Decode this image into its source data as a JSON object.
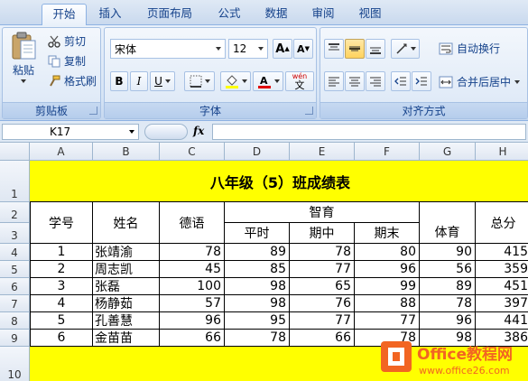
{
  "tabs": [
    "开始",
    "插入",
    "页面布局",
    "公式",
    "数据",
    "审阅",
    "视图"
  ],
  "clipboard": {
    "paste": "粘贴",
    "cut": "剪切",
    "copy": "复制",
    "format_painter": "格式刷",
    "label": "剪贴板"
  },
  "font": {
    "name": "宋体",
    "size": "12",
    "bold": "B",
    "italic": "I",
    "underline": "U",
    "grow": "A",
    "shrink": "A",
    "phonetic": "wén",
    "phonetic_char": "文",
    "label": "字体"
  },
  "alignment": {
    "wrap_text": "自动换行",
    "merge_center": "合并后居中",
    "label": "对齐方式"
  },
  "formula_bar": {
    "name_box": "K17",
    "fx": "fx"
  },
  "columns": [
    "A",
    "B",
    "C",
    "D",
    "E",
    "F",
    "G",
    "H"
  ],
  "rows": [
    "1",
    "2",
    "3",
    "4",
    "5",
    "6",
    "7",
    "8",
    "9",
    "10"
  ],
  "sheet": {
    "title": "八年级（5）班成绩表",
    "headers": {
      "id": "学号",
      "name": "姓名",
      "moral": "德语",
      "zhiyu": "智育",
      "regular": "平时",
      "mid": "期中",
      "final": "期末",
      "pe": "体育",
      "total": "总分"
    },
    "records": [
      [
        "1",
        "张靖渝",
        "78",
        "89",
        "78",
        "80",
        "90",
        "415"
      ],
      [
        "2",
        "周志凯",
        "45",
        "85",
        "77",
        "96",
        "56",
        "359"
      ],
      [
        "3",
        "张磊",
        "100",
        "98",
        "65",
        "99",
        "89",
        "451"
      ],
      [
        "4",
        "杨静茹",
        "57",
        "98",
        "76",
        "88",
        "78",
        "397"
      ],
      [
        "5",
        "孔善慧",
        "96",
        "95",
        "77",
        "77",
        "96",
        "441"
      ],
      [
        "6",
        "金苗苗",
        "66",
        "78",
        "66",
        "78",
        "98",
        "386"
      ]
    ]
  },
  "watermark": {
    "brand": "Office教程网",
    "url": "www.office26.com"
  },
  "colors": {
    "highlight": "#ffff00",
    "watermark_orange": "#f26522"
  }
}
